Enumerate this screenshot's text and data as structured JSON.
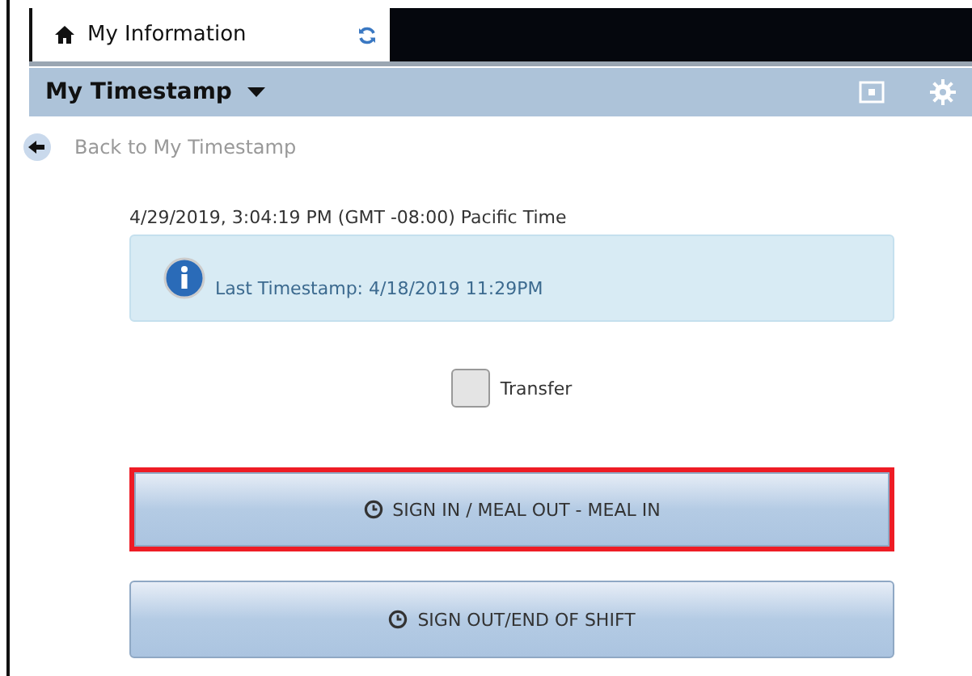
{
  "tab": {
    "label": "My Information"
  },
  "header": {
    "title": "My Timestamp"
  },
  "back_link": "Back to My Timestamp",
  "datetime": "4/29/2019, 3:04:19 PM (GMT -08:00) Pacific Time",
  "info": "Last Timestamp: 4/18/2019 11:29PM",
  "transfer": {
    "label": "Transfer",
    "checked": false
  },
  "buttons": [
    {
      "label": "SIGN IN / MEAL OUT - MEAL IN",
      "highlighted": true
    },
    {
      "label": "SIGN OUT/END OF SHIFT",
      "highlighted": false
    }
  ]
}
